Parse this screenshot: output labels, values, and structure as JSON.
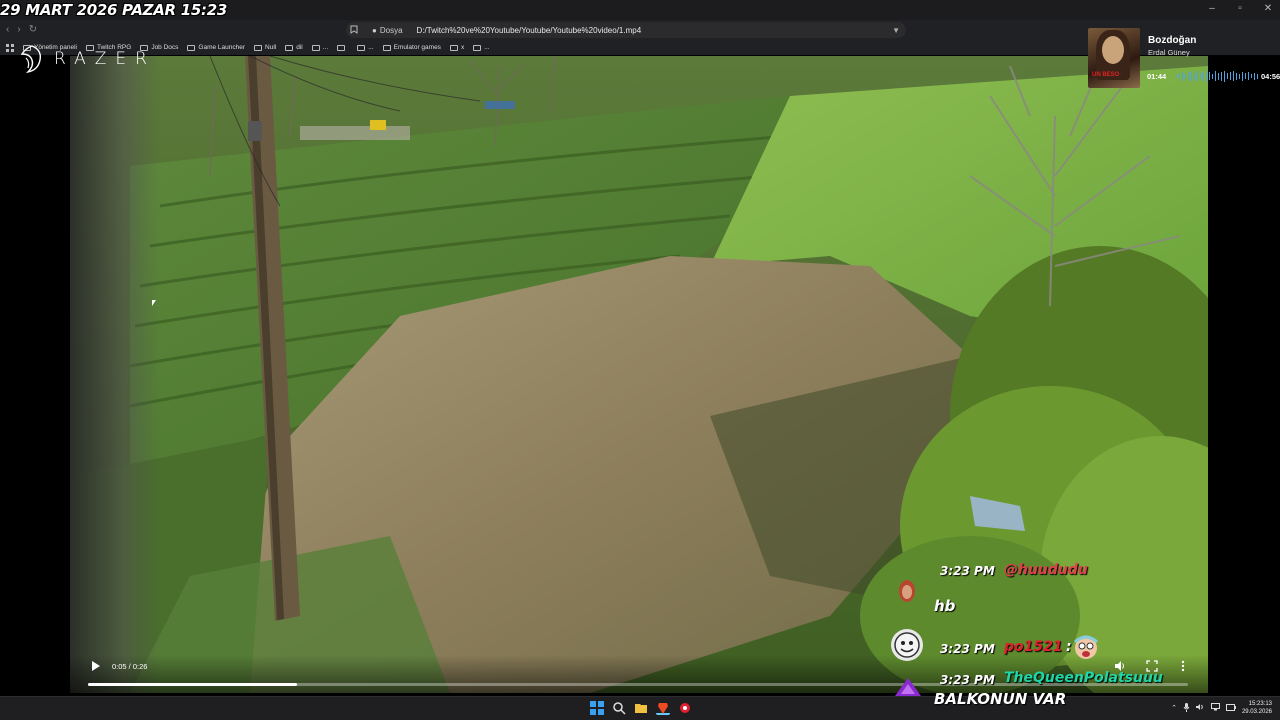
{
  "overlay": {
    "date_text": "29 MART 2026 PAZAR 15:23"
  },
  "window": {
    "minimize": "–",
    "restore": "▫",
    "close": "✕"
  },
  "address": {
    "security_label": "Dosya",
    "url": "D:/Twitch%20ve%20Youtube/Youtube/Youtube%20video/1.mp4"
  },
  "bookmarks": [
    {
      "label": "Yönetim paneli"
    },
    {
      "label": "Twitch RPG"
    },
    {
      "label": "Job Docs"
    },
    {
      "label": "Game Launcher"
    },
    {
      "label": "Null"
    },
    {
      "label": "dil"
    },
    {
      "label": "..."
    },
    {
      "label": ""
    },
    {
      "label": "..."
    },
    {
      "label": "Emulator games"
    },
    {
      "label": "x"
    },
    {
      "label": "..."
    }
  ],
  "brand": {
    "name": "RAZER"
  },
  "player": {
    "time_display": "0:05 / 0:26",
    "progress": 0.19
  },
  "music": {
    "title": "Bozdoğan",
    "artist": "Erdal Güney",
    "album_tag": "UN BESO",
    "current": "01:44",
    "total": "04:56",
    "accent": "#4fa3e0"
  },
  "chat": [
    {
      "time": "3:23 PM",
      "user": "@huududu",
      "user_color": "#e0404a",
      "text": "hb"
    },
    {
      "time": "3:23 PM",
      "user": "po1521",
      "user_color": "#e0202a",
      "text": ""
    },
    {
      "time": "3:23 PM",
      "user": "TheQueenPolatsuuu",
      "user_color": "#1fd6a6",
      "text": "BALKONUN VAR"
    }
  ],
  "taskbar": {
    "clock_time": "15:23:13",
    "clock_date": "29.03.2026"
  }
}
